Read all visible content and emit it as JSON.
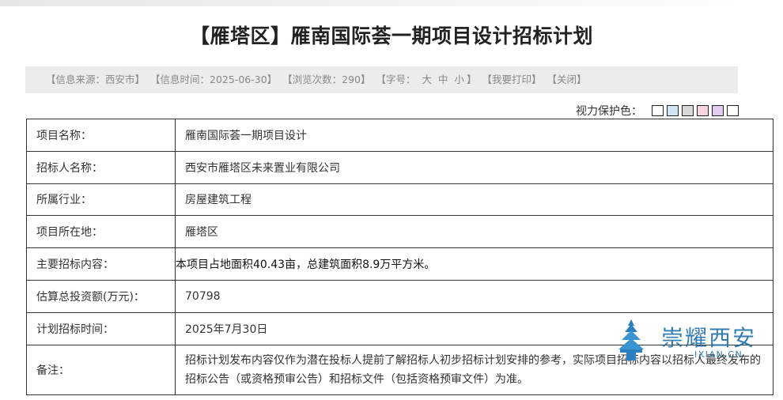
{
  "page": {
    "title": "【雁塔区】雁南国际荟一期项目设计招标计划"
  },
  "info_bar": {
    "source": "【信息来源：西安市】",
    "time": "【信息时间：2025-06-30】",
    "views": "【浏览次数：290】",
    "font_size_label": "【字号：",
    "font_size_options": [
      "大",
      "中",
      "小"
    ],
    "font_size_close": "】",
    "print": "【我要打印】",
    "close": "【关闭】"
  },
  "eye_protection": {
    "label": "视力保护色：",
    "colors": [
      "#ffffff",
      "#cfe6f5",
      "#d8d8d8",
      "#f6d6dc",
      "#e2ccf2",
      "#ffffff"
    ]
  },
  "table": {
    "rows": [
      {
        "label": "项目名称：",
        "value": "雁南国际荟一期项目设计"
      },
      {
        "label": "招标人名称：",
        "value": "西安市雁塔区未来置业有限公司"
      },
      {
        "label": "所属行业：",
        "value": "房屋建筑工程"
      },
      {
        "label": "项目所在地：",
        "value": "雁塔区"
      },
      {
        "label": "主要招标内容：",
        "value": "本项目占地面积40.43亩，总建筑面积8.9万平方米。"
      },
      {
        "label": "估算总投资额(万元)：",
        "value": "70798"
      },
      {
        "label": "计划招标时间：",
        "value": "2025年7月30日"
      },
      {
        "label": "备注：",
        "value": "招标计划发布内容仅作为潜在投标人提前了解招标人初步招标计划安排的参考，实际项目招标内容以招标人最终发布的招标公告（或资格预审公告）和招标文件（包括资格预审文件）为准。"
      }
    ]
  },
  "watermark": {
    "text": "崇耀西安",
    "sub": "IXIAN.CN"
  }
}
